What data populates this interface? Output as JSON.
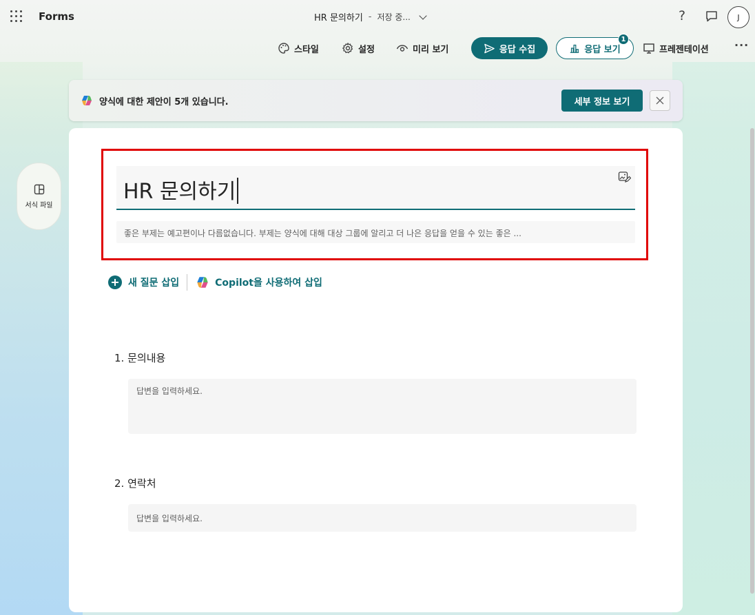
{
  "app": {
    "name": "Forms"
  },
  "document": {
    "title": "HR 문의하기",
    "separator": "-",
    "save_status": "저장 중..."
  },
  "header": {
    "help_glyph": "?",
    "avatar_initial": "J"
  },
  "toolbar": {
    "style_label": "스타일",
    "settings_label": "설정",
    "preview_label": "미리 보기",
    "collect_label": "응답 수집",
    "view_responses_label": "응답 보기",
    "view_responses_badge": "1",
    "present_label": "프레젠테이션",
    "more_glyph": "···"
  },
  "banner": {
    "message": "양식에 대한 제안이 5개 있습니다.",
    "details_button": "세부 정보 보기"
  },
  "layout_pane": {
    "label": "서식 파일"
  },
  "form": {
    "title": "HR 문의하기",
    "subtitle_placeholder": "좋은 부제는 예고편이나 다름없습니다. 부제는 양식에 대해 대상 그룹에 알리고 더 나은 응답을 얻을 수 있는 좋은 ...",
    "insert_question_label": "새 질문 삽입",
    "insert_copilot_label": "Copilot을 사용하여 삽입",
    "questions": [
      {
        "number": "1.",
        "label": "문의내용",
        "placeholder": "답변을 입력하세요."
      },
      {
        "number": "2.",
        "label": "연락처",
        "placeholder": "답변을 입력하세요."
      }
    ]
  },
  "colors": {
    "accent": "#0f6c75",
    "highlight_border": "#e00000"
  },
  "icons": {
    "waffle": "app-launcher-icon",
    "style": "palette-icon",
    "settings": "gear-icon",
    "preview": "eye-icon",
    "collect": "send-icon",
    "view": "bar-chart-icon",
    "present": "monitor-icon",
    "copilot": "copilot-icon"
  }
}
